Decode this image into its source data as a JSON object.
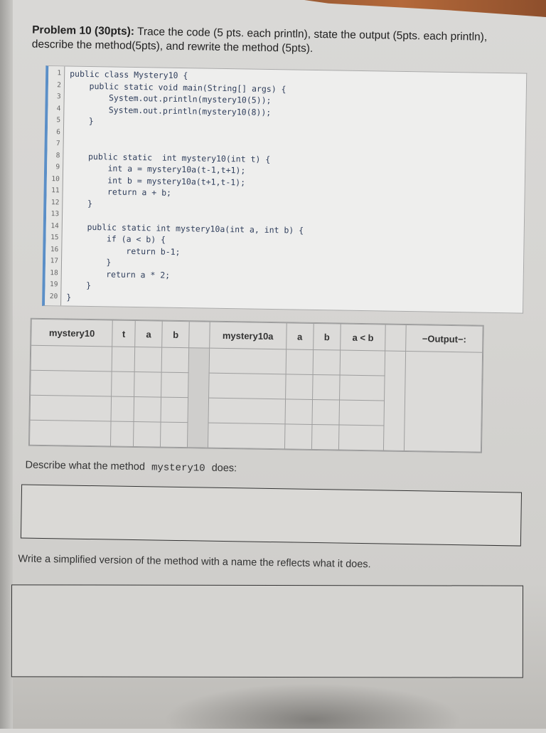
{
  "problem": {
    "heading": "Problem 10 (30pts):",
    "instructions": "Trace the code (5 pts. each println), state the output (5pts. each println), describe the method(5pts), and rewrite the method (5pts)."
  },
  "code": {
    "lines": [
      {
        "n": "1",
        "text": "public class Mystery10 {"
      },
      {
        "n": "2",
        "text": "    public static void main(String[] args) {"
      },
      {
        "n": "3",
        "text": "        System.out.println(mystery10(5));"
      },
      {
        "n": "4",
        "text": "        System.out.println(mystery10(8));"
      },
      {
        "n": "5",
        "text": "    }"
      },
      {
        "n": "6",
        "text": ""
      },
      {
        "n": "7",
        "text": ""
      },
      {
        "n": "8",
        "text": "    public static  int mystery10(int t) {"
      },
      {
        "n": "9",
        "text": "        int a = mystery10a(t-1,t+1);"
      },
      {
        "n": "10",
        "text": "        int b = mystery10a(t+1,t-1);"
      },
      {
        "n": "11",
        "text": "        return a + b;"
      },
      {
        "n": "12",
        "text": "    }"
      },
      {
        "n": "13",
        "text": ""
      },
      {
        "n": "14",
        "text": "    public static int mystery10a(int a, int b) {"
      },
      {
        "n": "15",
        "text": "        if (a < b) {"
      },
      {
        "n": "16",
        "text": "            return b-1;"
      },
      {
        "n": "17",
        "text": "        }"
      },
      {
        "n": "18",
        "text": "        return a * 2;"
      },
      {
        "n": "19",
        "text": "    }"
      },
      {
        "n": "20",
        "text": "}"
      }
    ]
  },
  "trace_table": {
    "headers": [
      "mystery10",
      "t",
      "a",
      "b",
      "",
      "mystery10a",
      "a",
      "b",
      "a < b",
      "",
      "−Output−:"
    ],
    "rows": [
      [
        "",
        "",
        "",
        "",
        "",
        "",
        "",
        "",
        "",
        "",
        ""
      ],
      [
        "",
        "",
        "",
        "",
        "",
        "",
        "",
        "",
        "",
        "",
        ""
      ],
      [
        "",
        "",
        "",
        "",
        "",
        "",
        "",
        "",
        "",
        "",
        ""
      ],
      [
        "",
        "",
        "",
        "",
        "",
        "",
        "",
        "",
        "",
        "",
        ""
      ]
    ]
  },
  "describe": {
    "label_before": "Describe what the method",
    "method_name": "mystery10",
    "label_after": "does:",
    "answer": ""
  },
  "rewrite": {
    "label": "Write a simplified version of the method with a name the reflects what it does.",
    "answer": ""
  }
}
